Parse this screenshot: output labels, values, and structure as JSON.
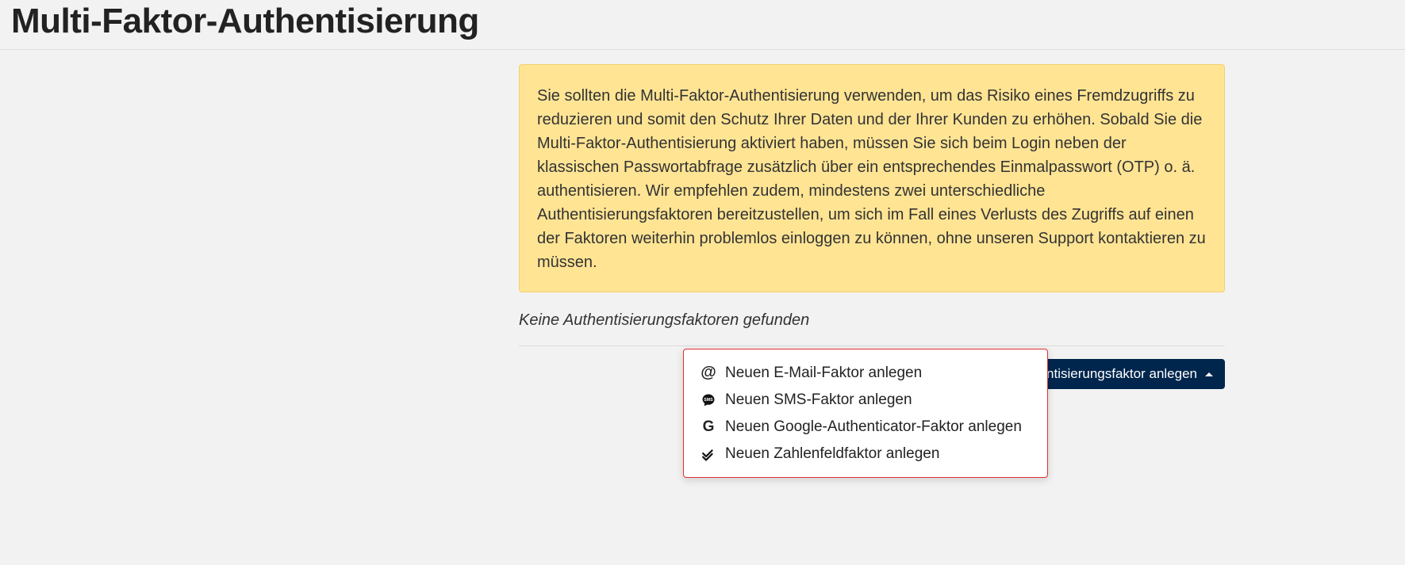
{
  "page": {
    "title": "Multi-Faktor-Authentisierung"
  },
  "alert": {
    "text": "Sie sollten die Multi-Faktor-Authentisierung verwenden, um das Risiko eines Fremdzugriffs zu reduzieren und somit den Schutz Ihrer Daten und der Ihrer Kunden zu erhöhen. Sobald Sie die Multi-Faktor-Authentisierung aktiviert haben, müssen Sie sich beim Login neben der klassischen Passwortabfrage zusätzlich über ein entsprechendes Einmalpasswort (OTP) o. ä. authentisieren. Wir empfehlen zudem, mindestens zwei unterschiedliche Authentisierungsfaktoren bereitzustellen, um sich im Fall eines Verlusts des Zugriffs auf einen der Faktoren weiterhin problemlos einloggen zu können, ohne unseren Support kontaktieren zu müssen."
  },
  "empty_state": {
    "message": "Keine Authentisierungsfaktoren gefunden"
  },
  "button": {
    "label": "Neuen Authentisierungsfaktor anlegen"
  },
  "dropdown": {
    "items": [
      {
        "label": "Neuen E-Mail-Faktor anlegen"
      },
      {
        "label": "Neuen SMS-Faktor anlegen"
      },
      {
        "label": "Neuen Google-Authenticator-Faktor anlegen"
      },
      {
        "label": "Neuen Zahlenfeldfaktor anlegen"
      }
    ]
  }
}
